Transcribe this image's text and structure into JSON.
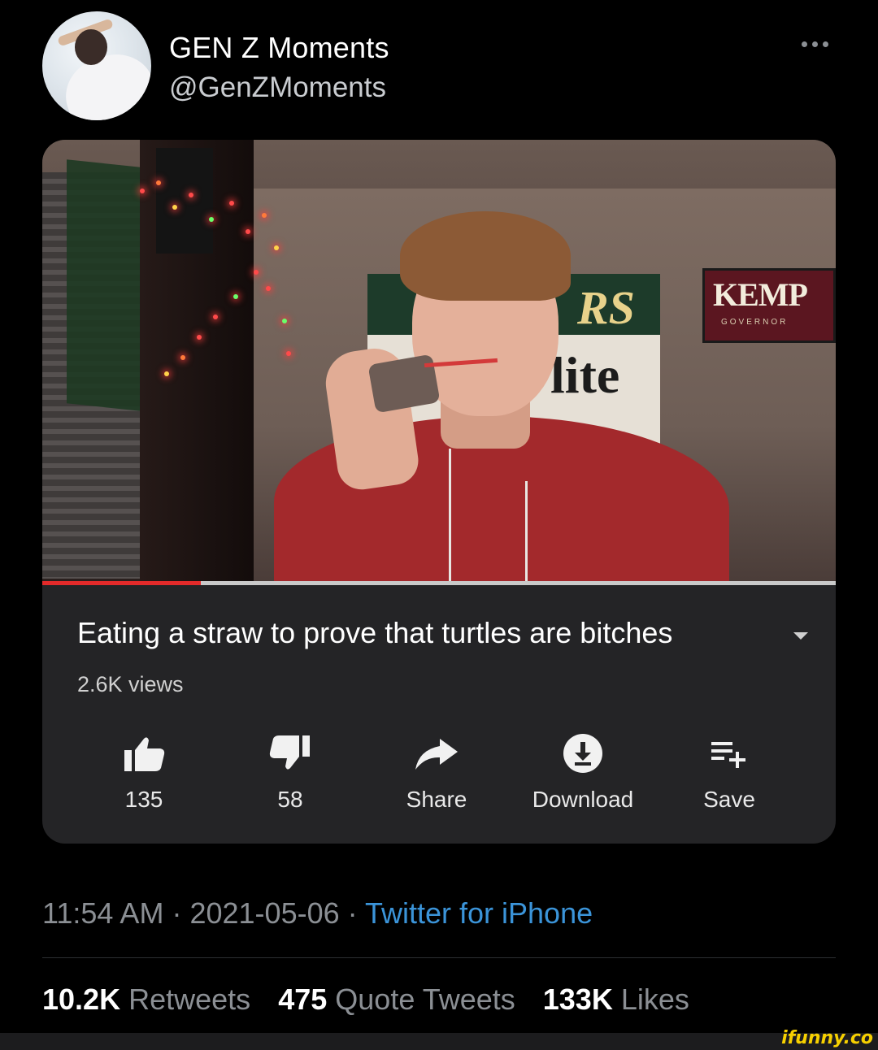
{
  "tweet": {
    "display_name": "GEN Z Moments",
    "handle": "@GenZMoments",
    "more_icon": "more-horizontal-icon"
  },
  "video": {
    "progress": 0.2,
    "scene_text": {
      "poster_top": "RS",
      "poster_bottom": "lite",
      "sign_name": "KEMP",
      "sign_sub": "GOVERNOR"
    },
    "title": "Eating a straw to prove that turtles are bitches",
    "views": "2.6K views",
    "actions": [
      {
        "icon": "thumbs-up-icon",
        "label": "135"
      },
      {
        "icon": "thumbs-down-icon",
        "label": "58"
      },
      {
        "icon": "share-icon",
        "label": "Share"
      },
      {
        "icon": "download-icon",
        "label": "Download"
      },
      {
        "icon": "playlist-add-icon",
        "label": "Save"
      }
    ]
  },
  "meta": {
    "time": "11:54 AM",
    "date": "2021-05-06",
    "separator": "·",
    "source": "Twitter for iPhone"
  },
  "stats": {
    "retweets_count": "10.2K",
    "retweets_label": "Retweets",
    "quotes_count": "475",
    "quotes_label": "Quote Tweets",
    "likes_count": "133K",
    "likes_label": "Likes"
  },
  "watermark": "ifunny.co",
  "colors": {
    "background": "#000000",
    "card": "#242426",
    "link": "#3b94d9",
    "progress": "#e32a2a",
    "muted": "#8b8f94"
  }
}
